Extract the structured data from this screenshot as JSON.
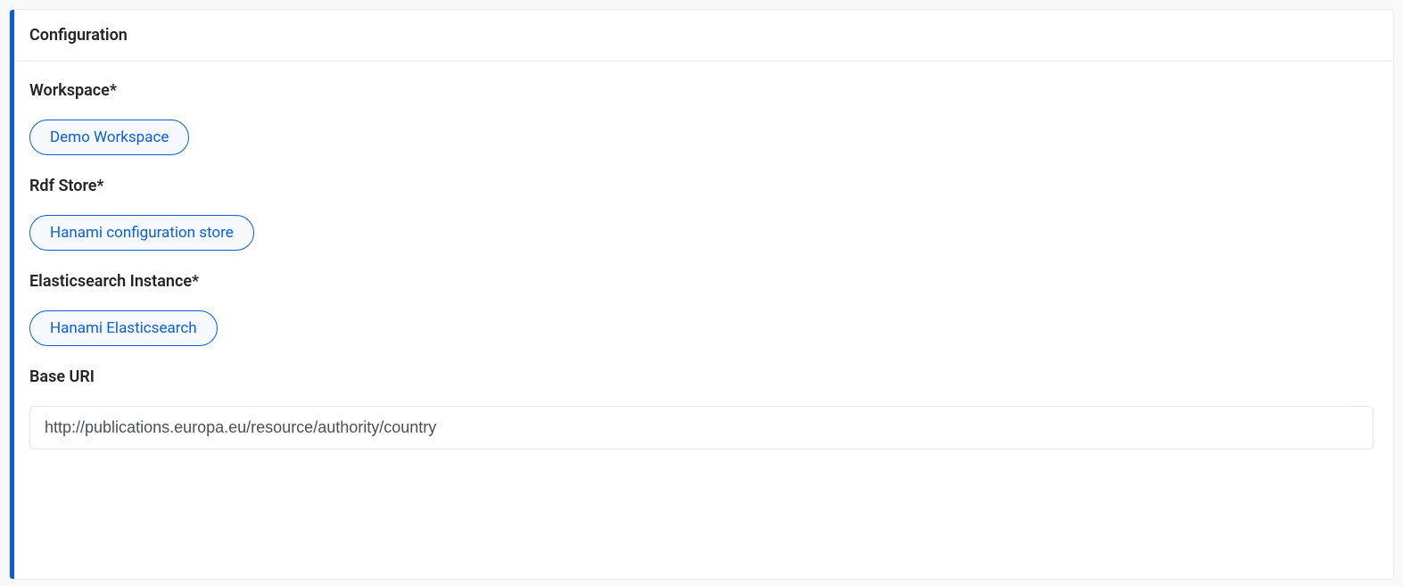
{
  "panel": {
    "title": "Configuration",
    "fields": {
      "workspace": {
        "label": "Workspace*",
        "chip": "Demo Workspace"
      },
      "rdfStore": {
        "label": "Rdf Store*",
        "chip": "Hanami configuration store"
      },
      "elasticsearch": {
        "label": "Elasticsearch Instance*",
        "chip": "Hanami Elasticsearch"
      },
      "baseUri": {
        "label": "Base URI",
        "value": "http://publications.europa.eu/resource/authority/country"
      }
    }
  }
}
